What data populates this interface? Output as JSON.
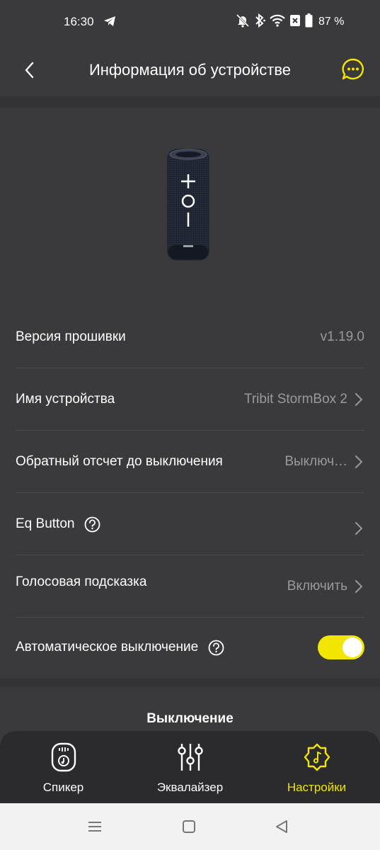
{
  "status": {
    "time": "16:30",
    "battery": "87 %"
  },
  "header": {
    "title": "Информация об устройстве"
  },
  "settings": {
    "firmware": {
      "label": "Версия прошивки",
      "value": "v1.19.0"
    },
    "device_name": {
      "label": "Имя устройства",
      "value": "Tribit StormBox 2"
    },
    "countdown": {
      "label": "Обратный отсчет до выключения",
      "value": "Выключ…"
    },
    "eq_button": {
      "label": "Eq Button",
      "value": ""
    },
    "voice_prompt": {
      "label": "Голосовая подсказка",
      "value": "Включить"
    },
    "auto_off": {
      "label": "Автоматическое выключение",
      "enabled": true
    }
  },
  "shutdown": {
    "label": "Выключение"
  },
  "tabs": [
    {
      "label": "Спикер",
      "icon": "speaker-icon",
      "active": false
    },
    {
      "label": "Эквалайзер",
      "icon": "equalizer-icon",
      "active": false
    },
    {
      "label": "Настройки",
      "icon": "settings-gear-icon",
      "active": true
    }
  ],
  "colors": {
    "accent": "#f2e600",
    "background": "#3a3a3c",
    "secondary_text": "#9a9a9d"
  }
}
